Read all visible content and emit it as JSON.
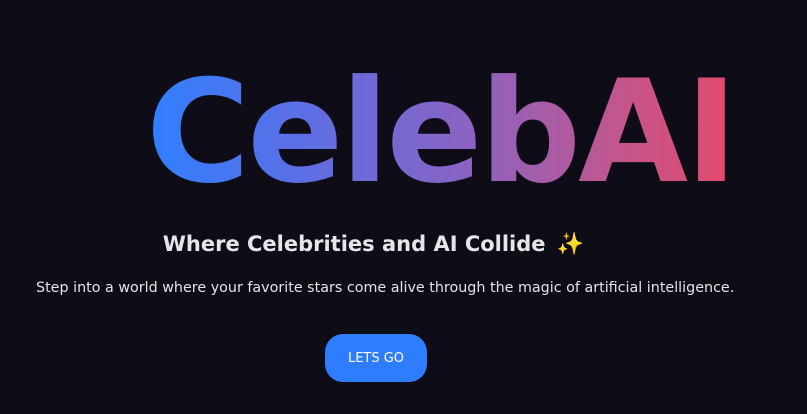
{
  "hero": {
    "title": "CelebAI",
    "tagline": "Where Celebrities and AI Collide",
    "tagline_icon": "sparkles-icon",
    "tagline_icon_glyph": "✨",
    "description": "Step into a world where your favorite stars come alive through the magic of artificial intelligence.",
    "cta_label": "LETS GO"
  },
  "colors": {
    "background": "#0e0d17",
    "gradient_start": "#2f80ff",
    "gradient_end": "#e5496a",
    "button": "#2f7dff"
  }
}
